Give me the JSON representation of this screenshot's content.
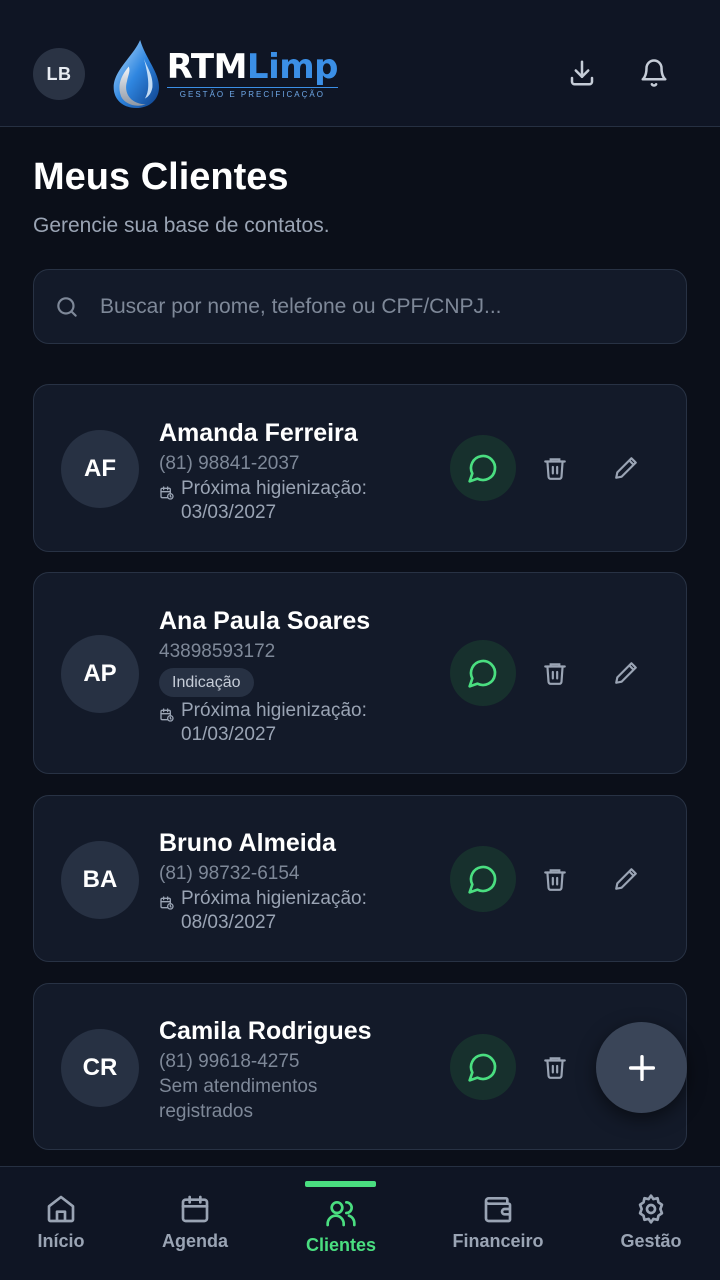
{
  "header": {
    "user_initials": "LB",
    "logo": {
      "brand_main": "RTM",
      "brand_accent": "Limp",
      "tagline": "GESTÃO E PRECIFICAÇÃO"
    },
    "icons": [
      "download-icon",
      "bell-icon"
    ]
  },
  "page": {
    "title": "Meus Clientes",
    "subtitle": "Gerencie sua base de contatos."
  },
  "search": {
    "placeholder": "Buscar por nome, telefone ou CPF/CNPJ...",
    "value": ""
  },
  "clients": [
    {
      "initials": "AF",
      "name": "Amanda Ferreira",
      "phone": "(81) 98841-2037",
      "tag": "",
      "next_label": "Próxima higienização:",
      "next_date": "03/03/2027"
    },
    {
      "initials": "AP",
      "name": "Ana Paula Soares",
      "phone": "43898593172",
      "tag": "Indicação",
      "next_label": "Próxima higienização:",
      "next_date": "01/03/2027"
    },
    {
      "initials": "BA",
      "name": "Bruno Almeida",
      "phone": "(81) 98732-6154",
      "tag": "",
      "next_label": "Próxima higienização:",
      "next_date": "08/03/2027"
    },
    {
      "initials": "CR",
      "name": "Camila Rodrigues",
      "phone": "(81) 99618-4275",
      "tag": "",
      "status_line1": "Sem atendimentos",
      "status_line2": "registrados"
    }
  ],
  "fab": {
    "icon": "plus-icon"
  },
  "nav": {
    "items": [
      {
        "label": "Início",
        "icon": "home-icon"
      },
      {
        "label": "Agenda",
        "icon": "calendar-icon"
      },
      {
        "label": "Clientes",
        "icon": "users-icon",
        "active": true
      },
      {
        "label": "Financeiro",
        "icon": "wallet-icon"
      },
      {
        "label": "Gestão",
        "icon": "gear-icon"
      }
    ]
  },
  "colors": {
    "background": "#0b0f19",
    "card": "#131a29",
    "accent_green": "#4ade80",
    "brand_blue": "#3b8fe6"
  }
}
